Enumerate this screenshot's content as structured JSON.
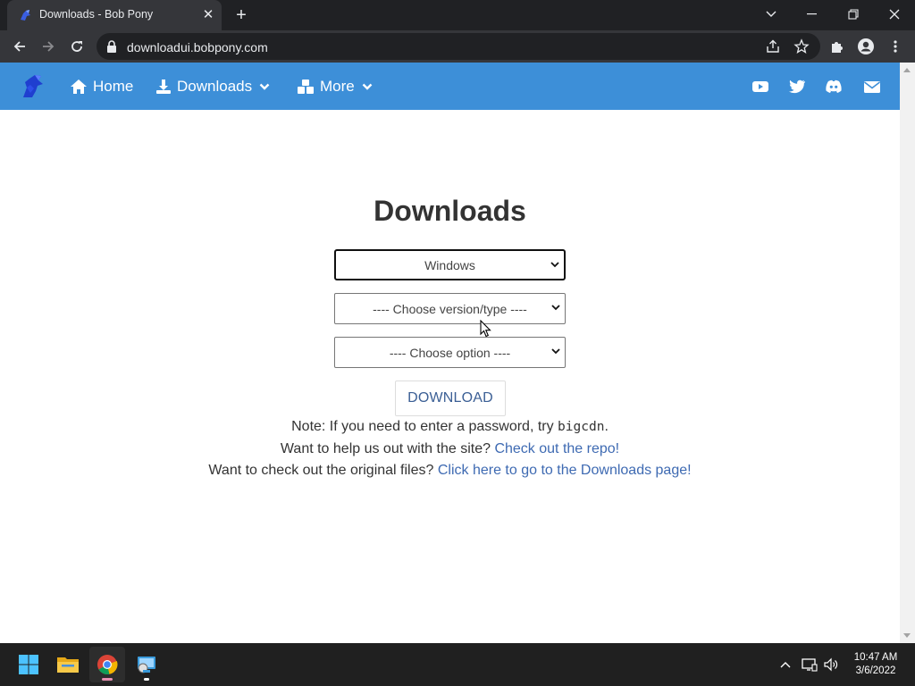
{
  "browser": {
    "tab_title": "Downloads - Bob Pony",
    "url": "downloadui.bobpony.com"
  },
  "navbar": {
    "home_label": "Home",
    "downloads_label": "Downloads",
    "more_label": "More"
  },
  "content": {
    "title": "Downloads",
    "os_select": "Windows",
    "version_select": "---- Choose version/type ----",
    "option_select": "---- Choose option ----",
    "download_button": "DOWNLOAD",
    "note_prefix": "Note: If you need to enter a password, try ",
    "note_code": "bigcdn",
    "note_suffix": ".",
    "help_prefix": "Want to help us out with the site? ",
    "help_link": "Check out the repo!",
    "files_prefix": "Want to check out the original files? ",
    "files_link": "Click here to go to the Downloads page!"
  },
  "taskbar": {
    "time": "10:47 AM",
    "date": "3/6/2022"
  },
  "colors": {
    "navbar": "#3d8fd8",
    "link": "#3e6ab2",
    "chrome_dark": "#202124",
    "chrome_toolbar": "#35363a"
  }
}
